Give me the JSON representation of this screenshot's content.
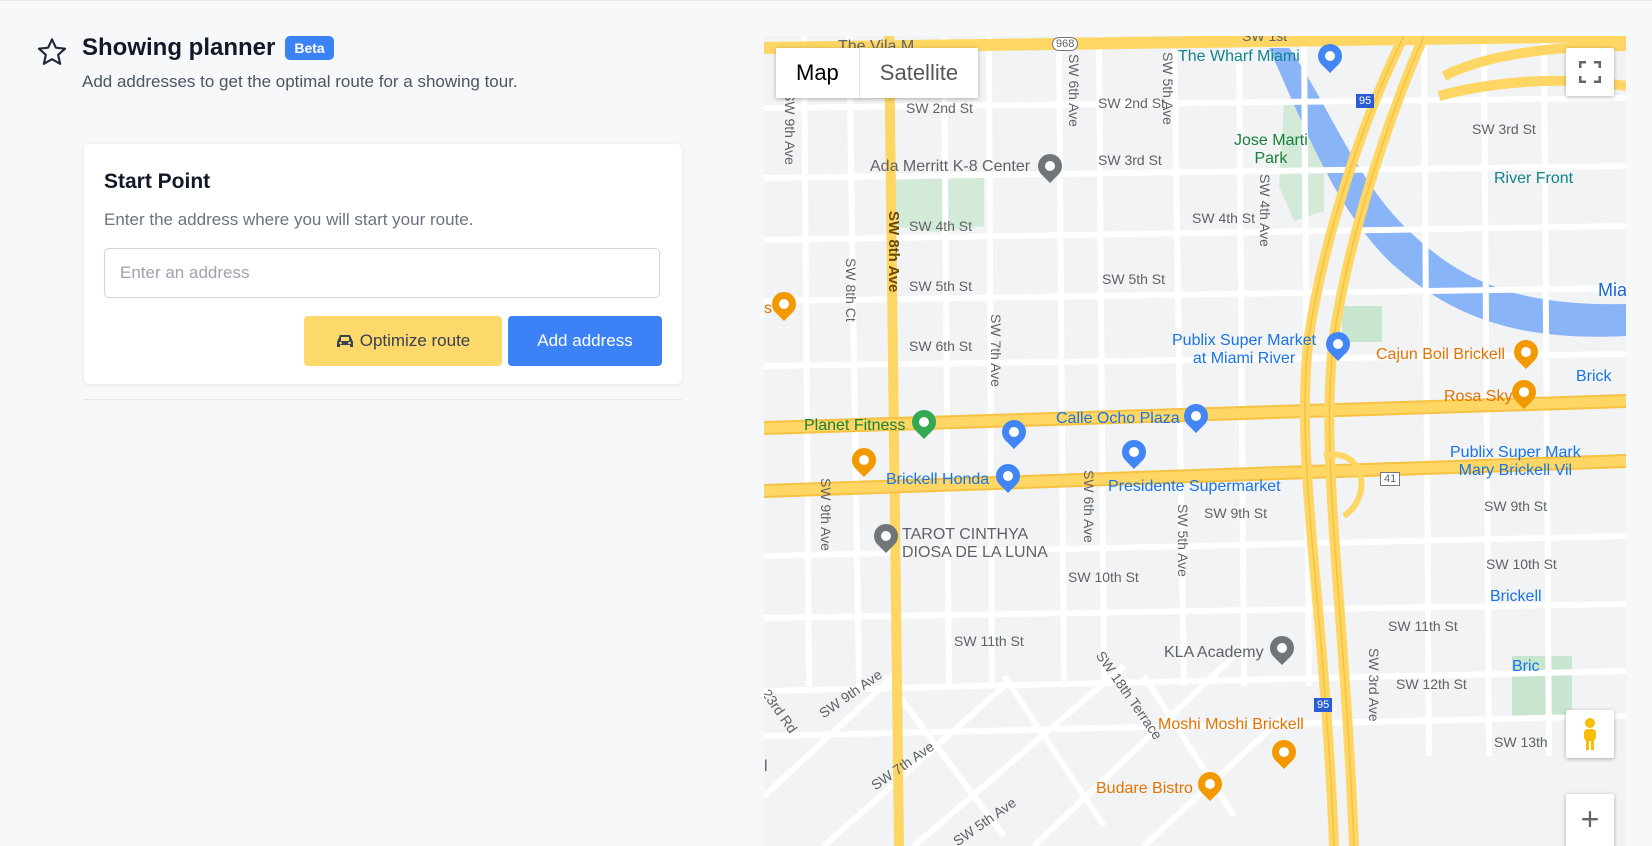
{
  "header": {
    "title": "Showing planner",
    "badge": "Beta",
    "subtitle": "Add addresses to get the optimal route for a showing tour."
  },
  "start_card": {
    "title": "Start Point",
    "description": "Enter the address where you will start your route.",
    "input_placeholder": "Enter an address",
    "input_value": "",
    "optimize_label": "Optimize route",
    "add_label": "Add address"
  },
  "map": {
    "type_tabs": [
      "Map",
      "Satellite"
    ],
    "active_type": "Map",
    "streets": {
      "sw_2nd_st_a": "SW 2nd St",
      "sw_2nd_st_b": "SW 2nd St",
      "sw_3rd_st_a": "SW 3rd St",
      "sw_3rd_st_b": "SW 3rd St",
      "sw_4th_st_a": "SW 4th St",
      "sw_4th_st_b": "SW 4th St",
      "sw_5th_st_a": "SW 5th St",
      "sw_5th_st_b": "SW 5th St",
      "sw_6th_st": "SW 6th St",
      "sw_9th_st_a": "SW 9th St",
      "sw_9th_st_b": "SW 9th St",
      "sw_10th_st_a": "SW 10th St",
      "sw_10th_st_b": "SW 10th St",
      "sw_11th_st_a": "SW 11th St",
      "sw_11th_st_b": "SW 11th St",
      "sw_12th_st": "SW 12th St",
      "sw_13th": "SW 13th",
      "sw_8th_ave": "SW 8th Ave",
      "sw_9th_ave_a": "SW 9th Ave",
      "sw_9th_ave_b": "SW 9th Ave",
      "sw_9th_ave_c": "SW 9th Ave",
      "sw_8th_ct": "SW 8th Ct",
      "sw_6th_ave_a": "SW 6th Ave",
      "sw_6th_ave_b": "SW 6th Ave",
      "sw_5th_ave_a": "SW 5th Ave",
      "sw_5th_ave_b": "SW 5th Ave",
      "sw_5th_ave_c": "SW 5th Ave",
      "sw_7th_ave_a": "SW 7th Ave",
      "sw_7th_ave_b": "SW 7th Ave",
      "sw_4th_ave": "SW 4th Ave",
      "sw_3rd_ave": "SW 3rd Ave",
      "sw_18th_terrace": "SW 18th Terrace",
      "sw_23rd_rd": "23rd Rd",
      "sw_1st_fragment": "SW 1st",
      "route_968": "968",
      "route_95a": "95",
      "route_95b": "95",
      "route_41": "41",
      "miami_river": "Mia"
    },
    "pois": {
      "wharf": "The Wharf Miami",
      "jose_marti_1": "Jose Marti",
      "jose_marti_2": "Park",
      "ada_merritt": "Ada Merritt K-8 Center",
      "river_front": "River Front",
      "publix_river_1": "Publix Super Market",
      "publix_river_2": "at Miami River",
      "cajun": "Cajun Boil Brickell",
      "brick_fragment": "Brick",
      "rosa_sky": "Rosa Sky",
      "planet_fitness": "Planet Fitness",
      "calle_ocho": "Calle Ocho Plaza",
      "publix_mary_1": "Publix Super Mark",
      "publix_mary_2": "Mary Brickell Vil",
      "brickell_honda": "Brickell Honda",
      "presidente": "Presidente Supermarket",
      "tarot_1": "TAROT CINTHYA",
      "tarot_2": "DIOSA DE LA LUNA",
      "brickell_station": "Brickell",
      "brick_fragment_2": "Bric",
      "kla": "KLA Academy",
      "moshi": "Moshi Moshi Brickell",
      "budare": "Budare Bistro",
      "vila_fragment": "The Vila M",
      "s_fragment": "s",
      "l_fragment": "l"
    },
    "zoom_in": "+",
    "zoom_out": "−"
  }
}
